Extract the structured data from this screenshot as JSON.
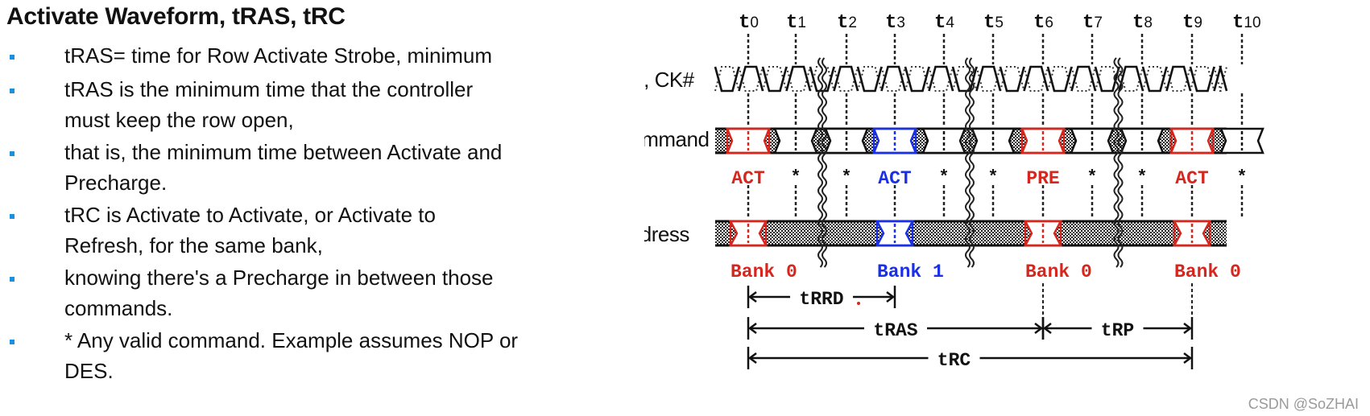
{
  "slide": {
    "title": "Activate Waveform, tRAS, tRC",
    "bullets": [
      {
        "text": "tRAS= time for Row Activate Strobe, minimum"
      },
      {
        "text": "tRAS is the minimum time that the controller\nmust keep the row open,"
      },
      {
        "text": "that is, the minimum time between Activate and\nPrecharge."
      },
      {
        "text": "tRC is Activate to Activate, or Activate to\nRefresh, for the same bank,"
      },
      {
        "text": "knowing there's a Precharge in between those\ncommands."
      },
      {
        "text": "* Any valid command. Example assumes NOP or\nDES."
      }
    ],
    "bullet_color": "#1b8fe0",
    "watermark": "CSDN @SoZHAI"
  },
  "diagram": {
    "signals": [
      "CK, CK#",
      "Command",
      "Address"
    ],
    "time_labels": [
      "t0",
      "t1",
      "t2",
      "t3",
      "t4",
      "t5",
      "t6",
      "t7",
      "t8",
      "t9",
      "t10"
    ],
    "breaks_after": [
      "t1",
      "t4",
      "t7"
    ],
    "commands": [
      {
        "at": "t0",
        "label": "ACT",
        "color": "#d7261e"
      },
      {
        "at": "t1",
        "label": "*",
        "color": "#111111"
      },
      {
        "at": "t2",
        "label": "*",
        "color": "#111111"
      },
      {
        "at": "t3",
        "label": "ACT",
        "color": "#1a2fe8"
      },
      {
        "at": "t4",
        "label": "*",
        "color": "#111111"
      },
      {
        "at": "t5",
        "label": "*",
        "color": "#111111"
      },
      {
        "at": "t6",
        "label": "PRE",
        "color": "#d7261e"
      },
      {
        "at": "t7",
        "label": "*",
        "color": "#111111"
      },
      {
        "at": "t8",
        "label": "*",
        "color": "#111111"
      },
      {
        "at": "t9",
        "label": "ACT",
        "color": "#d7261e"
      },
      {
        "at": "t10",
        "label": "*",
        "color": "#111111"
      }
    ],
    "addresses": [
      {
        "at": "t0",
        "label": "Bank 0",
        "color": "#d7261e"
      },
      {
        "at": "t3",
        "label": "Bank 1",
        "color": "#1a2fe8"
      },
      {
        "at": "t6",
        "label": "Bank 0",
        "color": "#d7261e"
      },
      {
        "at": "t9",
        "label": "Bank 0",
        "color": "#d7261e"
      }
    ],
    "intervals": [
      {
        "label": "tRRD",
        "from": "t0",
        "to": "t3",
        "row": 0
      },
      {
        "label": "tRAS",
        "from": "t0",
        "to": "t6",
        "row": 1
      },
      {
        "label": "tRP",
        "from": "t6",
        "to": "t9",
        "row": 1
      },
      {
        "label": "tRC",
        "from": "t0",
        "to": "t9",
        "row": 2
      }
    ]
  }
}
